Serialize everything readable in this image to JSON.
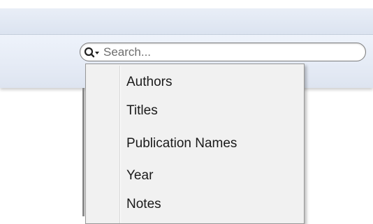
{
  "search": {
    "placeholder": "Search...",
    "icon": "search-icon",
    "dropdown_icon": "chevron-down-icon"
  },
  "menu": {
    "items": [
      {
        "label": "Authors"
      },
      {
        "label": "Titles"
      },
      {
        "label": "Publication Names"
      },
      {
        "label": "Year"
      },
      {
        "label": "Notes"
      }
    ]
  },
  "colors": {
    "toolbar": "#e3e9f4",
    "title_band": "#dbe3f0",
    "menu_background": "#f1f1f1",
    "menu_border": "#979797"
  }
}
